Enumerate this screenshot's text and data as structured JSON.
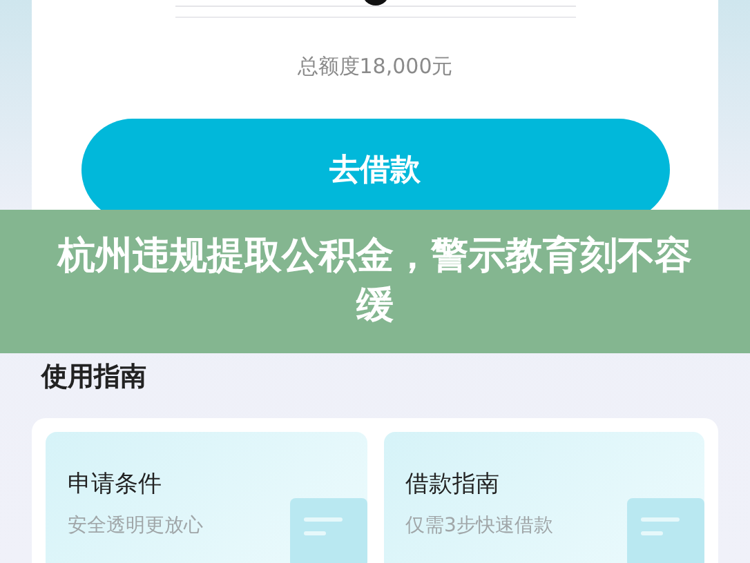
{
  "loan_card": {
    "slider": {
      "level": 0.5
    },
    "total_limit": "总额度18,000元",
    "borrow_button": "去借款"
  },
  "headline": "杭州违规提取公积金，警示教育刻不容缓",
  "guide": {
    "title": "使用指南",
    "tiles": [
      {
        "title": "申请条件",
        "subtitle": "安全透明更放心"
      },
      {
        "title": "借款指南",
        "subtitle": "仅需3步快速借款"
      }
    ]
  }
}
